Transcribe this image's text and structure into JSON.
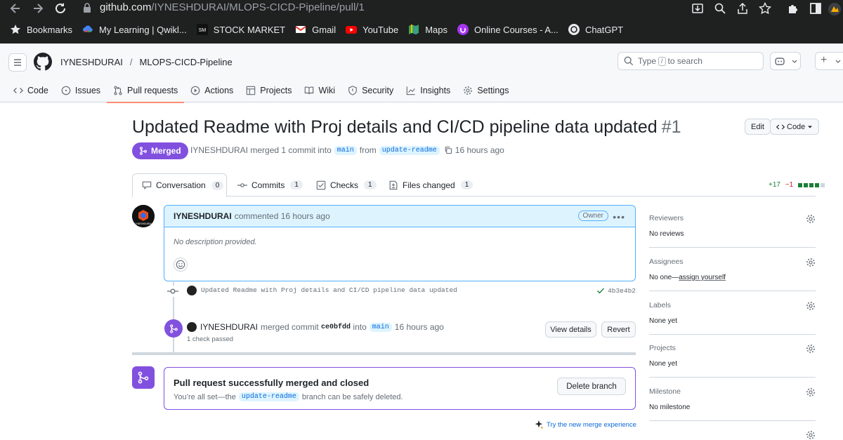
{
  "browser": {
    "url_host": "github.com",
    "url_path": "/IYNESHDURAI/MLOPS-CICD-Pipeline/pull/1",
    "bookmarks": [
      {
        "label": "Bookmarks",
        "icon": "star-icon",
        "color": "#e8eaed"
      },
      {
        "label": "My Learning | Qwikl...",
        "icon": "google-cloud-icon",
        "color": "#4285f4"
      },
      {
        "label": "STOCK MARKET",
        "icon": "stock-icon",
        "color": "#222"
      },
      {
        "label": "Gmail",
        "icon": "gmail-icon",
        "color": "#ea4335"
      },
      {
        "label": "YouTube",
        "icon": "youtube-icon",
        "color": "#ff0000"
      },
      {
        "label": "Maps",
        "icon": "maps-icon",
        "color": "#34a853"
      },
      {
        "label": "Online Courses - A...",
        "icon": "udemy-icon",
        "color": "#a435f0"
      },
      {
        "label": "ChatGPT",
        "icon": "chatgpt-icon",
        "color": "#e8eaed"
      }
    ]
  },
  "header": {
    "owner": "IYNESHDURAI",
    "separator": "/",
    "repo": "MLOPS-CICD-Pipeline",
    "search_prefix": "Type",
    "search_key": "/",
    "search_suffix": "to search",
    "plus": "+"
  },
  "repo_tabs": [
    {
      "label": "Code",
      "icon": "code-icon"
    },
    {
      "label": "Issues",
      "icon": "issue-icon"
    },
    {
      "label": "Pull requests",
      "icon": "pull-request-icon",
      "active": true
    },
    {
      "label": "Actions",
      "icon": "play-icon"
    },
    {
      "label": "Projects",
      "icon": "table-icon"
    },
    {
      "label": "Wiki",
      "icon": "book-icon"
    },
    {
      "label": "Security",
      "icon": "shield-icon"
    },
    {
      "label": "Insights",
      "icon": "graph-icon"
    },
    {
      "label": "Settings",
      "icon": "gear-icon"
    }
  ],
  "pr": {
    "title": "Updated Readme with Proj details and CI/CD pipeline data updated",
    "number": "#1",
    "edit_label": "Edit",
    "code_label": "Code",
    "state": "Merged",
    "author": "IYNESHDURAI",
    "merged_text": "merged 1 commit into",
    "base": "main",
    "from_text": "from",
    "head": "update-readme",
    "time": "16 hours ago"
  },
  "pr_tabs": {
    "conversation": {
      "label": "Conversation",
      "count": "0"
    },
    "commits": {
      "label": "Commits",
      "count": "1"
    },
    "checks": {
      "label": "Checks",
      "count": "1"
    },
    "files": {
      "label": "Files changed",
      "count": "1"
    }
  },
  "diffstat": {
    "additions": "+17",
    "deletions": "−1",
    "color_add": "#1a7f37",
    "color_del": "#cf222e"
  },
  "comment": {
    "author": "IYNESHDURAI",
    "action": "commented 16 hours ago",
    "role": "Owner",
    "body": "No description provided."
  },
  "commit": {
    "message": "Updated Readme with Proj details and CI/CD pipeline data updated",
    "sha": "4b3e4b2"
  },
  "merge_event": {
    "author": "IYNESHDURAI",
    "text": "merged commit",
    "sha": "ce0bfdd",
    "into": "into",
    "branch": "main",
    "time": "16 hours ago",
    "checks": "1 check passed",
    "view_details": "View details",
    "revert": "Revert"
  },
  "merge_box": {
    "title": "Pull request successfully merged and closed",
    "sub_prefix": "You’re all set—the",
    "branch": "update-readme",
    "sub_suffix": "branch can be safely deleted.",
    "delete_label": "Delete branch"
  },
  "try_new": "Try the new merge experience",
  "sidebar": {
    "reviewers": {
      "title": "Reviewers",
      "value": "No reviews"
    },
    "assignees": {
      "title": "Assignees",
      "value": "No one—",
      "link": "assign yourself"
    },
    "labels": {
      "title": "Labels",
      "value": "None yet"
    },
    "projects": {
      "title": "Projects",
      "value": "None yet"
    },
    "milestone": {
      "title": "Milestone",
      "value": "No milestone"
    }
  }
}
